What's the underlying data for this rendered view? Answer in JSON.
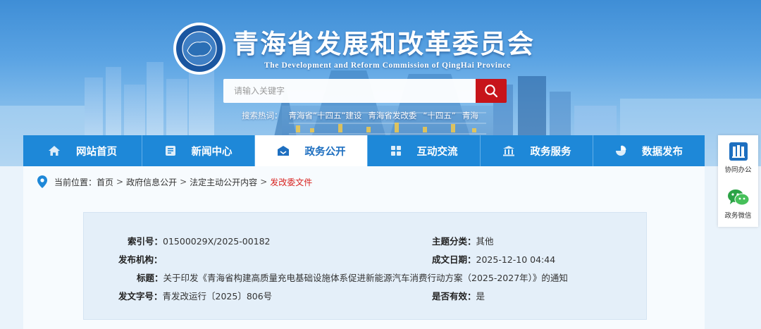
{
  "header": {
    "title_cn": "青海省发展和改革委员会",
    "title_en": "The Development and Reform Commission of QingHai Province",
    "emblem_icon": "provincial-emblem"
  },
  "search": {
    "placeholder": "请输入关键字",
    "hot_label": "搜索热词：",
    "hot_words": [
      "青海省“十四五”建设",
      "青海省发改委",
      "“十四五”",
      "青海"
    ]
  },
  "nav": {
    "items": [
      {
        "label": "网站首页",
        "icon": "home-icon"
      },
      {
        "label": "新闻中心",
        "icon": "news-icon"
      },
      {
        "label": "政务公开",
        "icon": "open-gov-icon",
        "active": true
      },
      {
        "label": "互动交流",
        "icon": "interaction-icon"
      },
      {
        "label": "政务服务",
        "icon": "service-icon"
      },
      {
        "label": "数据发布",
        "icon": "data-chart-icon"
      }
    ]
  },
  "float": {
    "items": [
      {
        "label": "协同办公",
        "icon": "office-building-icon"
      },
      {
        "label": "政务微信",
        "icon": "wechat-icon"
      }
    ]
  },
  "breadcrumb": {
    "label": "当前位置：",
    "items": [
      "首页",
      "政府信息公开",
      "法定主动公开内容"
    ],
    "current": "发改委文件",
    "separator": ">"
  },
  "document": {
    "index_label": "索引号：",
    "index_value": "01500029X/2025-00182",
    "topic_label": "主题分类：",
    "topic_value": "其他",
    "publisher_label": "发布机构：",
    "publisher_value": "",
    "date_label": "成文日期：",
    "date_value": "2025-12-10 04:44",
    "title_label": "标题：",
    "title_value": "关于印发《青海省构建高质量充电基础设施体系促进新能源汽车消费行动方案（2025-2027年）》的通知",
    "docno_label": "发文字号：",
    "docno_value": "青发改运行〔2025〕806号",
    "valid_label": "是否有效：",
    "valid_value": "是"
  },
  "colors": {
    "nav_blue": "#1e88d8",
    "search_red": "#c7141a",
    "crumb_current": "#d8221f"
  }
}
